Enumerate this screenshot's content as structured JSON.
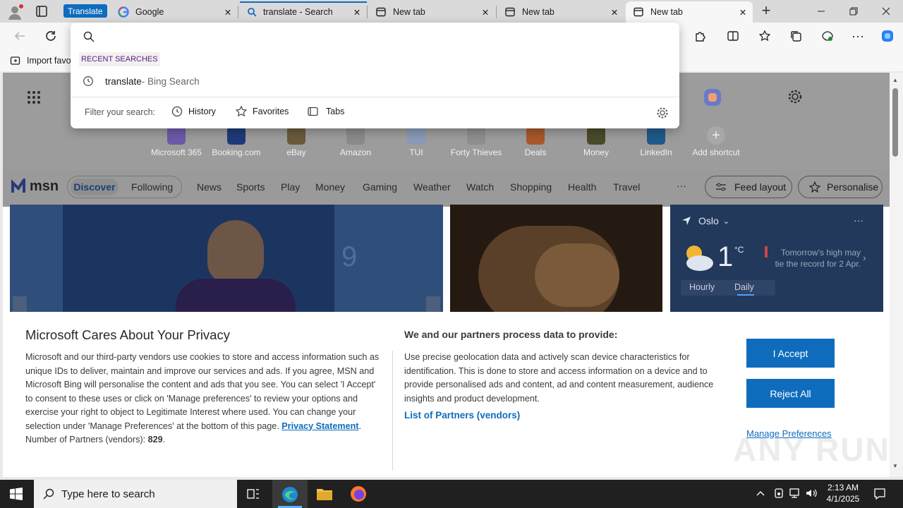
{
  "tabs": {
    "group_label": "Translate",
    "items": [
      {
        "title": "Google",
        "icon": "google-icon"
      },
      {
        "title": "translate - Search",
        "icon": "search-icon"
      },
      {
        "title": "New tab",
        "icon": "newtab-icon"
      },
      {
        "title": "New tab",
        "icon": "newtab-icon"
      },
      {
        "title": "New tab",
        "icon": "newtab-icon",
        "active": true
      }
    ]
  },
  "favbar": {
    "import_label": "Import favo"
  },
  "omnibox": {
    "recent_header": "RECENT SEARCHES",
    "recent": [
      {
        "query": "translate",
        "suffix": " - Bing Search"
      }
    ],
    "filter_label": "Filter your search:",
    "filters": [
      "History",
      "Favorites",
      "Tabs"
    ]
  },
  "shortcuts": [
    "Microsoft 365",
    "Booking.com",
    "eBay",
    "Amazon",
    "TUI",
    "Forty Thieves",
    "Deals",
    "Money",
    "LinkedIn",
    "Add shortcut"
  ],
  "msn": {
    "logo": "msn",
    "tabs": [
      "Discover",
      "Following"
    ],
    "nav": [
      "News",
      "Sports",
      "Play",
      "Money",
      "Gaming",
      "Weather",
      "Watch",
      "Shopping",
      "Health",
      "Travel"
    ],
    "more": "···",
    "feed_layout": "Feed layout",
    "personalise": "Personalise"
  },
  "video_overlay": "9",
  "weather": {
    "city": "Oslo",
    "temp": "1",
    "unit": "°C",
    "note": "Tomorrow's high may tie the record for 2 Apr.",
    "tabs": [
      "Hourly",
      "Daily"
    ]
  },
  "consent": {
    "title": "Microsoft Cares About Your Privacy",
    "body": "Microsoft and our third-party vendors use cookies to store and access information such as unique IDs to deliver, maintain and improve our services and ads. If you agree, MSN and Microsoft Bing will personalise the content and ads that you see. You can select 'I Accept' to consent to these uses or click on 'Manage preferences' to review your options and exercise your right to object to Legitimate Interest where used. You can change your selection under 'Manage Preferences' at the bottom of this page.",
    "privacy_link": "Privacy Statement",
    "partners_label": "Number of Partners (vendors):",
    "partners_count": "829",
    "right_title": "We and our partners process data to provide:",
    "right_body": "Use precise geolocation data and actively scan device characteristics for identification. This is done to store and access information on a device and to provide personalised ads and content, ad and content measurement, audience insights and product development.",
    "partners_link": "List of Partners (vendors)",
    "accept": "I Accept",
    "reject": "Reject All",
    "manage": "Manage Preferences"
  },
  "watermark": "ANY RUN",
  "taskbar": {
    "search_placeholder": "Type here to search",
    "time": "2:13 AM",
    "date": "4/1/2025"
  },
  "colors": {
    "accent": "#0f6cbd",
    "link": "#0f6cbd",
    "taskbar": "#202020"
  }
}
